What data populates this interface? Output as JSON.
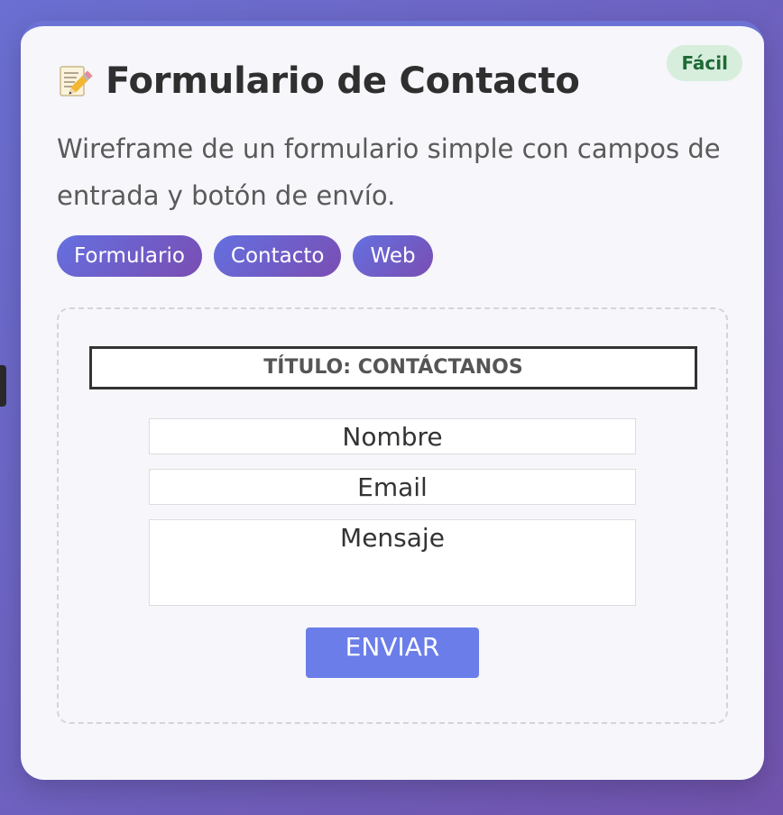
{
  "card": {
    "badge": "Fácil",
    "title_icon": "memo-pencil-icon",
    "title": "Formulario de Contacto",
    "description": "Wireframe de un formulario simple con campos de entrada y botón de envío.",
    "tags": [
      "Formulario",
      "Contacto",
      "Web"
    ]
  },
  "wireframe": {
    "header": "TÍTULO: CONTÁCTANOS",
    "fields": {
      "name": "Nombre",
      "email": "Email",
      "message": "Mensaje"
    },
    "button": "ENVIAR"
  },
  "colors": {
    "background_start": "#6a6fd1",
    "background_end": "#7153ad",
    "card": "#f6f6fb",
    "badge_bg": "#d7eedc",
    "badge_text": "#1e6a36",
    "tag_start": "#6470e0",
    "tag_end": "#7a4db2",
    "button": "#6a7de8"
  }
}
